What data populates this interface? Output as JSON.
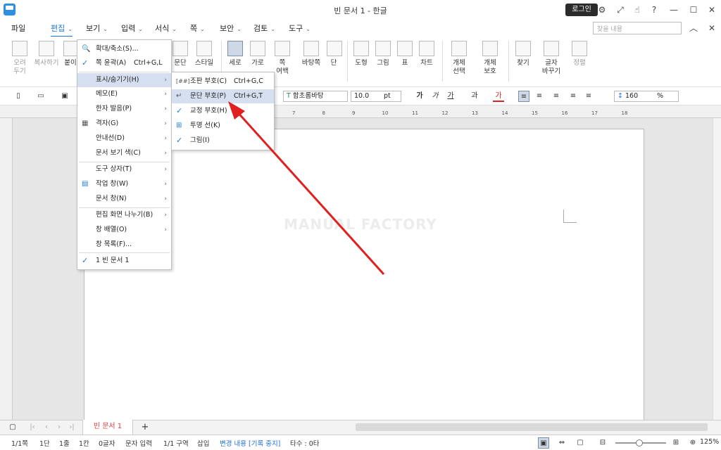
{
  "window": {
    "title": "빈 문서 1 - 한글",
    "login": "로그인"
  },
  "menubar": {
    "items": [
      "파일",
      "편집",
      "보기",
      "입력",
      "서식",
      "쪽",
      "보안",
      "검토",
      "도구"
    ],
    "search_placeholder": "찾을 내용"
  },
  "ribbon": {
    "buttons": [
      {
        "label": "오려\n두기"
      },
      {
        "label": "복사하기"
      },
      {
        "label": "붙이"
      },
      {
        "label": "문단"
      },
      {
        "label": "스타일"
      },
      {
        "label": "세로"
      },
      {
        "label": "가로"
      },
      {
        "label": "쪽\n여백"
      },
      {
        "label": "바탕쪽"
      },
      {
        "label": "단"
      },
      {
        "label": "도형"
      },
      {
        "label": "그림"
      },
      {
        "label": "표"
      },
      {
        "label": "차트"
      },
      {
        "label": "개체\n선택"
      },
      {
        "label": "개체\n보호"
      },
      {
        "label": "찾기"
      },
      {
        "label": "글자\n바꾸기"
      },
      {
        "label": "정렬"
      }
    ]
  },
  "toolbar2": {
    "font": "함초롬바탕",
    "size": "10.0",
    "size_unit": "pt",
    "line_spacing": "160",
    "line_unit": "%",
    "bold": "가",
    "italic": "가",
    "underline": "가",
    "strike": "과",
    "color": "가"
  },
  "ruler": {
    "ticks": [
      "1",
      "2",
      "3",
      "4",
      "5",
      "6",
      "7",
      "8",
      "9",
      "10",
      "11",
      "12",
      "13",
      "14",
      "15",
      "16",
      "17",
      "18"
    ]
  },
  "watermark": "MANUAL FACTORY",
  "view_menu": {
    "items": [
      {
        "label": "확대/축소(S)...",
        "icon": "magnifier-icon"
      },
      {
        "label": "쪽 윤곽(A)",
        "shortcut": "Ctrl+G,L",
        "checked": true
      },
      {
        "label": "표시/숨기기(H)",
        "submenu": true,
        "highlight": true
      },
      {
        "label": "메모(E)",
        "submenu": true
      },
      {
        "label": "한자 발음(P)",
        "submenu": true
      },
      {
        "label": "격자(G)",
        "submenu": true,
        "icon": "grid-icon"
      },
      {
        "label": "안내선(D)",
        "submenu": true
      },
      {
        "label": "문서 보기 색(C)",
        "submenu": true
      },
      {
        "label": "도구 상자(T)",
        "submenu": true
      },
      {
        "label": "작업 창(W)",
        "submenu": true,
        "icon": "task-pane-icon"
      },
      {
        "label": "문서 창(N)",
        "submenu": true
      },
      {
        "label": "편집 화면 나누기(B)",
        "submenu": true
      },
      {
        "label": "창 배열(O)",
        "submenu": true
      },
      {
        "label": "창 목록(F)..."
      },
      {
        "label": "1 빈 문서 1",
        "checked": true
      }
    ]
  },
  "show_hide_menu": {
    "items": [
      {
        "label": "조판 부호(C)",
        "shortcut": "Ctrl+G,C",
        "icon": "[##]"
      },
      {
        "label": "문단 부호(P)",
        "shortcut": "Ctrl+G,T",
        "highlight": true
      },
      {
        "label": "교정 부호(H)",
        "checked": true
      },
      {
        "label": "투명 선(K)",
        "icon": "table-icon"
      },
      {
        "label": "그림(I)",
        "checked": true
      }
    ]
  },
  "tabs": {
    "doc": "빈 문서 1"
  },
  "status": {
    "page": "1/1쪽",
    "col": "1단",
    "line": "1줄",
    "char": "1칸",
    "count": "0글자",
    "mode": "문자 입력",
    "section": "1/1 구역",
    "insert": "삽입",
    "track": "변경 내용 [기록 중지]",
    "strokes": "타수 : 0타",
    "zoom": "125%"
  },
  "colors": {
    "accent": "#1e78d7",
    "arrow": "#e02020",
    "tab_text": "#e23b3b"
  }
}
